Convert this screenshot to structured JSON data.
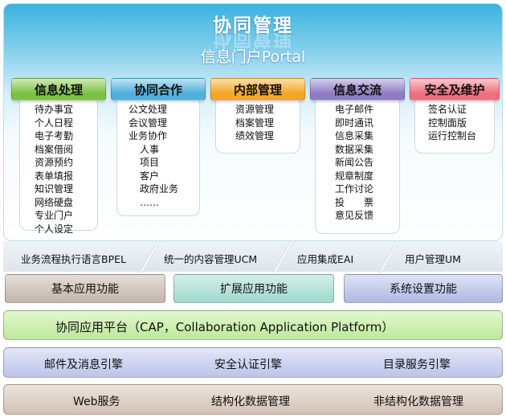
{
  "header": {
    "title": "协同管理",
    "subtitle": "信息门户Portal"
  },
  "categories": [
    {
      "title": "信息处理",
      "color": "#7cc242",
      "items": [
        "待办事宜",
        "个人日程",
        "电子考勤",
        "档案借阅",
        "资源预约",
        "表单填报",
        "知识管理",
        "网络硬盘",
        "专业门户",
        "个人设定"
      ]
    },
    {
      "title": "协同合作",
      "color": "#4fb0dc",
      "items": [
        "公文处理",
        "会议管理",
        "业务协作"
      ],
      "sub_items": [
        "人事",
        "项目",
        "客户",
        "政府业务",
        "……"
      ]
    },
    {
      "title": "内部管理",
      "color": "#f5a623",
      "items": [
        "资源管理",
        "档案管理",
        "绩效管理"
      ]
    },
    {
      "title": "信息交流",
      "color": "#8e7cc3",
      "items": [
        "电子邮件",
        "即时通讯",
        "信息采集",
        "数据采集",
        "新闻公告",
        "规章制度",
        "工作讨论",
        "投　　票",
        "意见反馈"
      ]
    },
    {
      "title": "安全及维护",
      "color": "#ef6f7f",
      "items": [
        "签名认证",
        "控制面版",
        "运行控制台"
      ]
    }
  ],
  "services": [
    "业务流程执行语言BPEL",
    "统一的内容管理UCM",
    "应用集成EAI",
    "用户管理UM"
  ],
  "functions": [
    {
      "label": "基本应用功能",
      "color": "#ccbfb5"
    },
    {
      "label": "扩展应用功能",
      "color": "#a6ddd3"
    },
    {
      "label": "系统设置功能",
      "color": "#b7c1e6"
    }
  ],
  "platform": {
    "label": "协同应用平台（CAP，Collaboration Application Platform）",
    "color": "#c6eca4"
  },
  "engines": {
    "color": "#c3c9ea",
    "items": [
      "邮件及消息引擎",
      "安全认证引擎",
      "目录服务引擎"
    ]
  },
  "data_layer": {
    "color": "#d8c9bd",
    "items": [
      "Web服务",
      "结构化数据管理",
      "非结构化数据管理"
    ]
  }
}
